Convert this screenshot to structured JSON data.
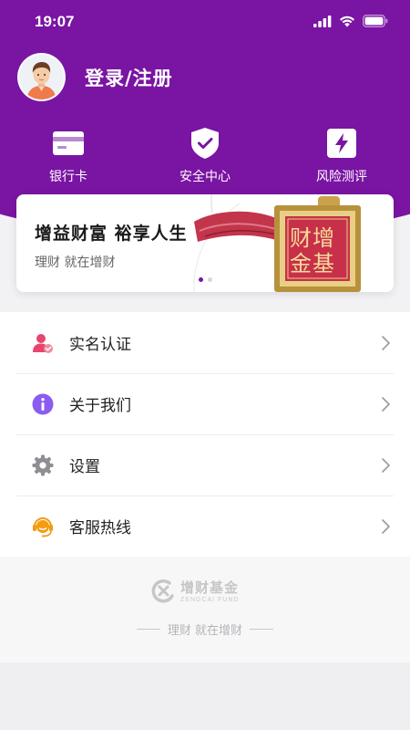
{
  "status_bar": {
    "time": "19:07",
    "icons": [
      "signal-icon",
      "wifi-icon",
      "battery-icon"
    ]
  },
  "profile": {
    "login_label": "登录/注册",
    "avatar_icon": "user-avatar"
  },
  "quick_actions": [
    {
      "label": "银行卡",
      "icon": "bank-card-icon"
    },
    {
      "label": "安全中心",
      "icon": "shield-check-icon"
    },
    {
      "label": "风险测评",
      "icon": "lightning-icon"
    }
  ],
  "banner": {
    "title": "增益财富 裕享人生",
    "subtitle": "理财 就在增财",
    "seal_text": [
      "增",
      "财",
      "基",
      "金"
    ],
    "active_slide": 1,
    "slide_count": 2
  },
  "menu": [
    {
      "label": "实名认证",
      "icon": "user-verified-icon",
      "color": "#e8456e"
    },
    {
      "label": "关于我们",
      "icon": "info-icon",
      "color": "#8a5cf0"
    },
    {
      "label": "设置",
      "icon": "gear-icon",
      "color": "#8e8e93"
    },
    {
      "label": "客服热线",
      "icon": "headset-icon",
      "color": "#f39c12"
    }
  ],
  "footer": {
    "logo_cn": "增财基金",
    "logo_en": "ZENGCAI FUND",
    "slogan": "理财 就在增财"
  },
  "colors": {
    "brand": "#7a14a3",
    "background": "#f2f2f4"
  }
}
